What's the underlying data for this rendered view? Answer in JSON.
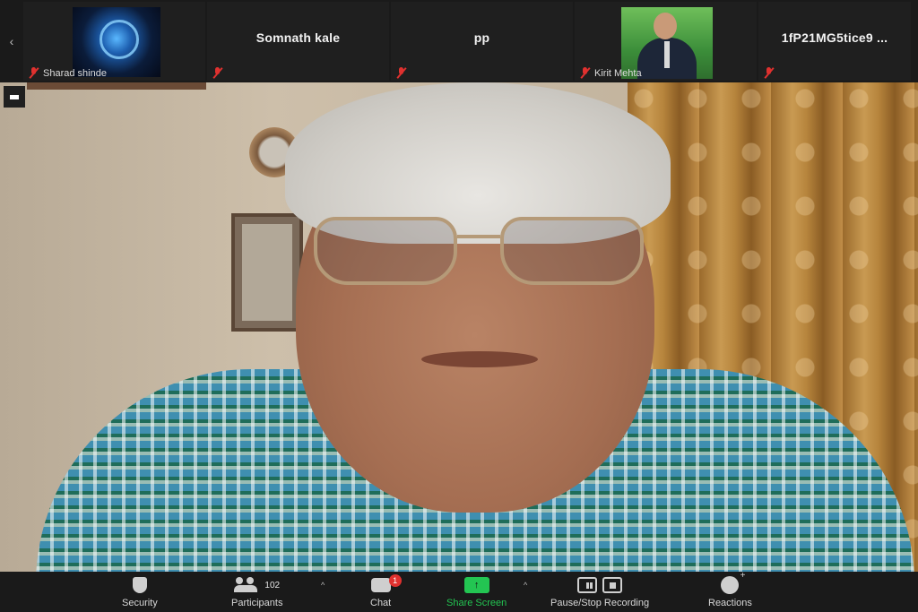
{
  "strip": {
    "left_arrow": "‹",
    "tiles": [
      {
        "name": "Sharad shinde",
        "avatar": "blue-abstract-avatar"
      },
      {
        "name": "Somnath kale"
      },
      {
        "name": "pp"
      },
      {
        "name": "Kirit Mehta",
        "avatar": "man-in-suit-photo"
      },
      {
        "name": "1fP21MG5tice9 ..."
      }
    ]
  },
  "toolbar": {
    "security": "Security",
    "participants": "Participants",
    "participant_count": "102",
    "chat": "Chat",
    "chat_badge": "1",
    "share": "Share Screen",
    "record": "Pause/Stop Recording",
    "reactions": "Reactions",
    "caret": "^"
  },
  "colors": {
    "background": "#1a1a1a",
    "share_green": "#23c552",
    "mute_red": "#e0312f"
  }
}
